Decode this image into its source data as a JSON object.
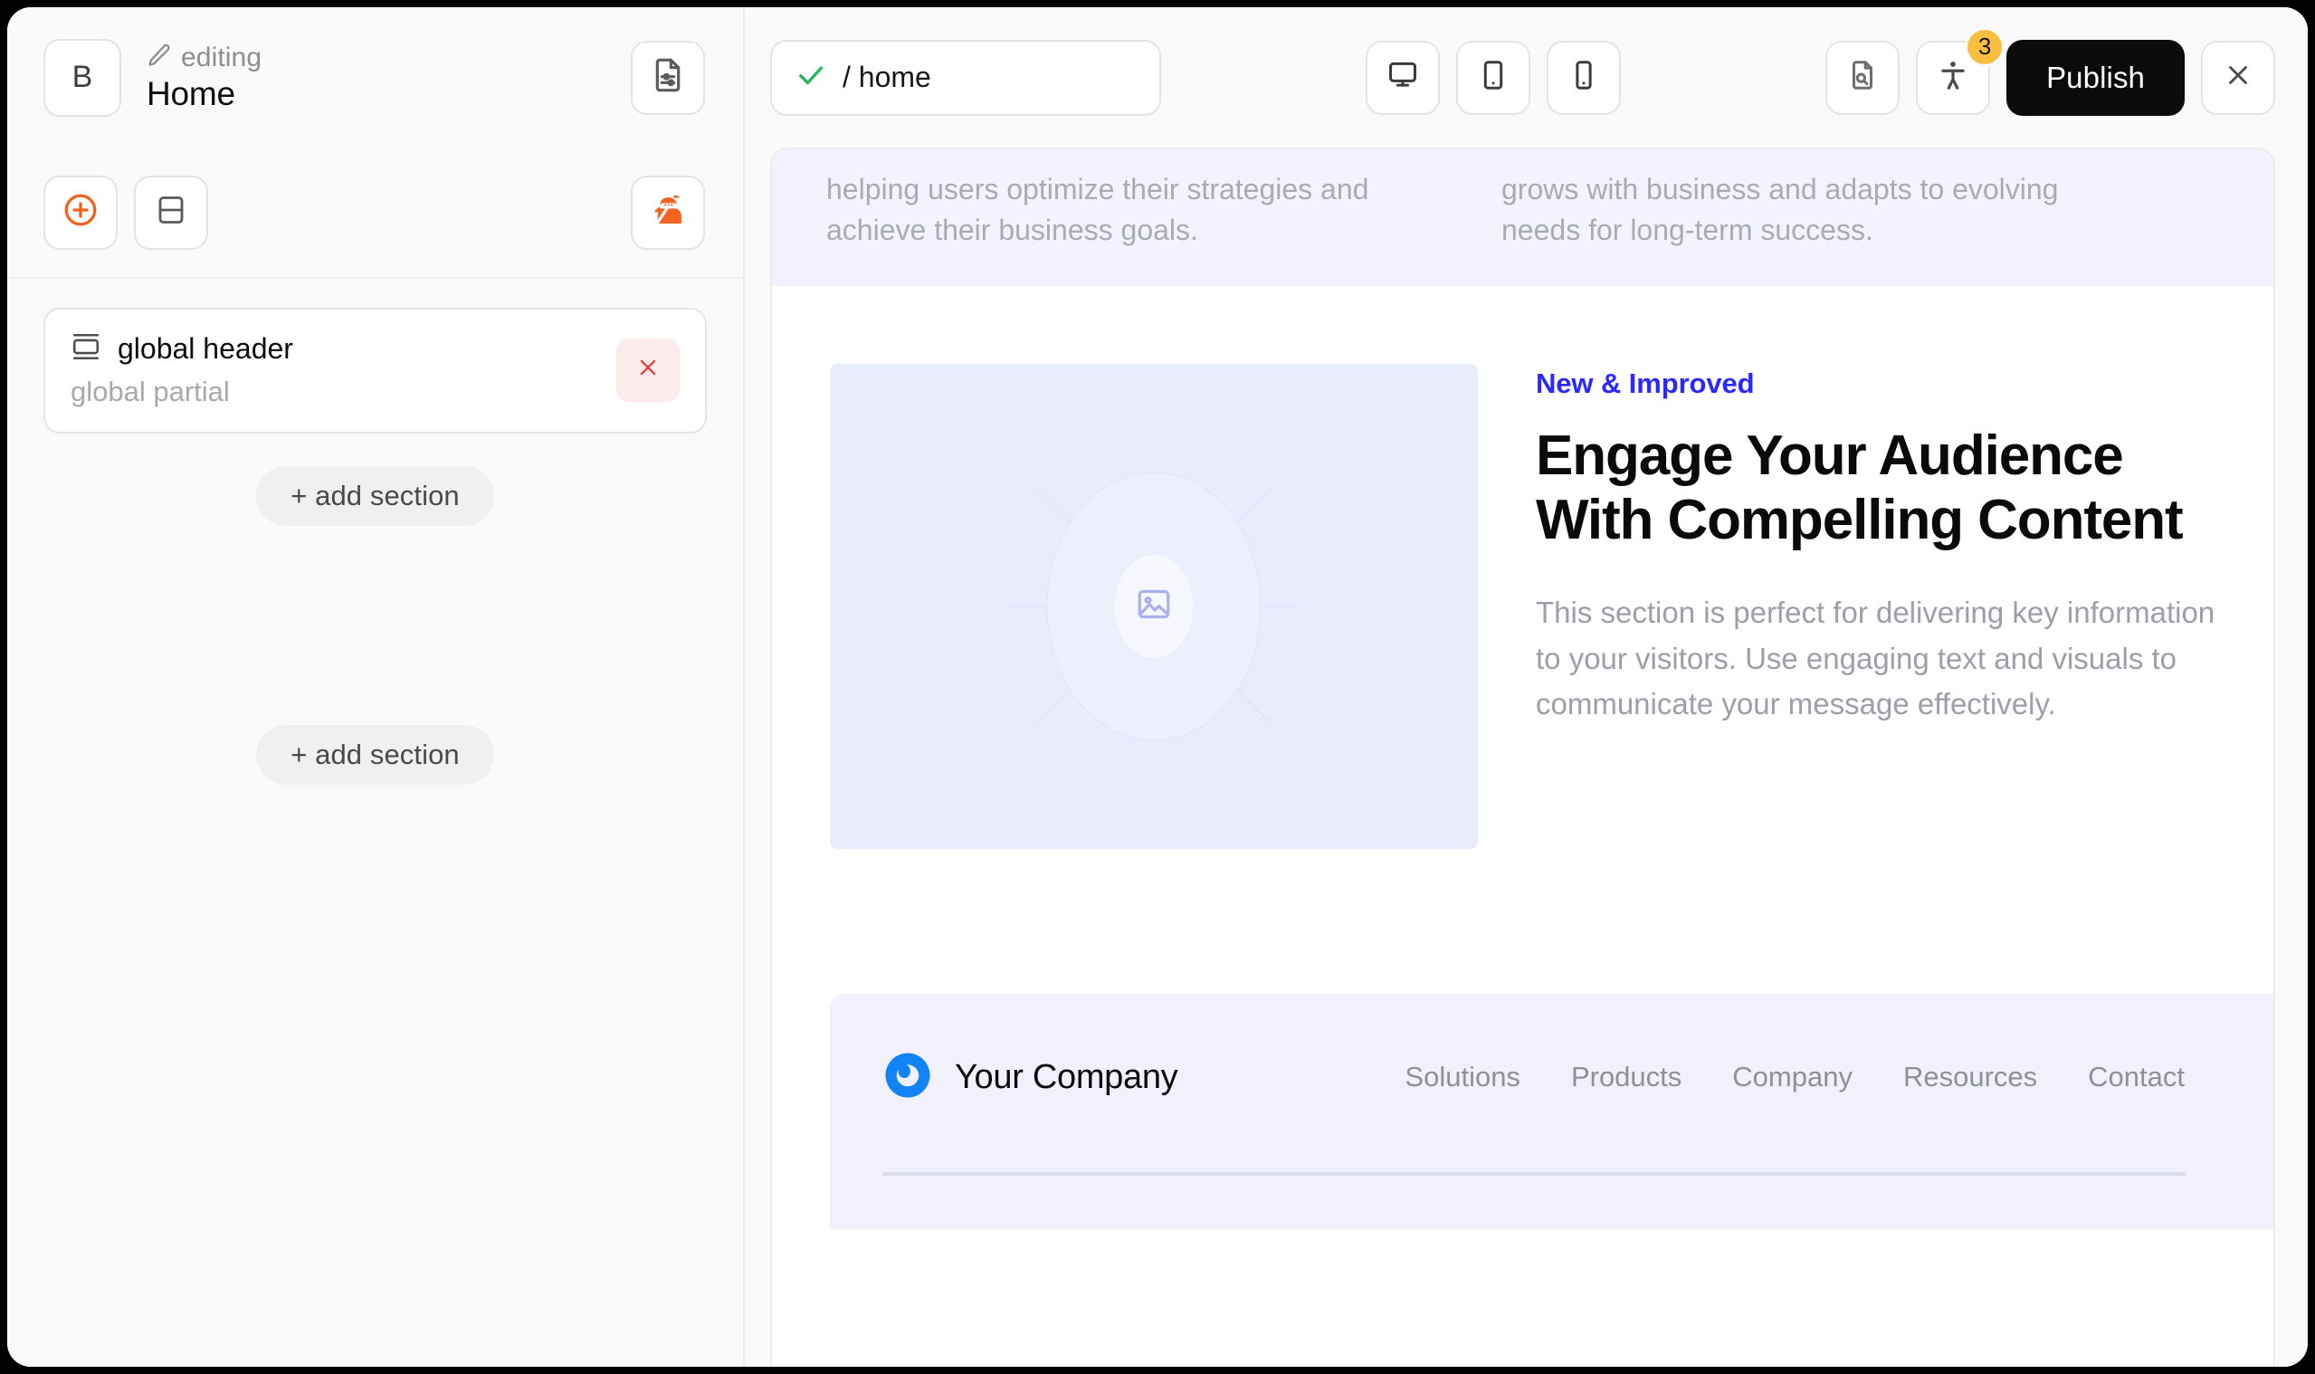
{
  "left_panel": {
    "brand_initial": "B",
    "editing_label": "editing",
    "page_title": "Home",
    "page_settings_icon": "document-sliders-icon",
    "add_block_icon": "plus-circle-icon",
    "layout_icon": "split-layout-icon",
    "assistant_icon": "ninja-mascot-icon",
    "sections": [
      {
        "icon": "global-header-icon",
        "title": "global header",
        "subtitle": "global partial",
        "delete_label": "✕"
      }
    ],
    "add_section_label": "+ add section",
    "add_section_label_2": "+ add section"
  },
  "toolbar": {
    "url_status_icon": "check-icon",
    "url_value": "/ home",
    "url_placeholder": "/ home",
    "devices": [
      {
        "name": "desktop",
        "icon": "desktop-icon",
        "active": true
      },
      {
        "name": "tablet",
        "icon": "tablet-icon",
        "active": false
      },
      {
        "name": "mobile",
        "icon": "mobile-icon",
        "active": false
      }
    ],
    "seo_icon": "document-search-icon",
    "accessibility_icon": "accessibility-icon",
    "accessibility_badge": "3",
    "publish_label": "Publish",
    "close_label": "✕"
  },
  "canvas": {
    "band_top": {
      "left_text": "helping users optimize their strategies and achieve their business goals.",
      "right_text": "grows with business and adapts to evolving needs for long-term success."
    },
    "hero": {
      "image_placeholder_icon": "image-placeholder-icon",
      "eyebrow": "New & Improved",
      "heading": "Engage Your Audience With Compelling Content",
      "paragraph": "This section is perfect for delivering key information to your visitors. Use engaging text and visuals to communicate your message effectively."
    },
    "footer": {
      "logo_icon": "company-logo-icon",
      "company_name": "Your Company",
      "nav": [
        {
          "label": "Solutions"
        },
        {
          "label": "Products"
        },
        {
          "label": "Company"
        },
        {
          "label": "Resources"
        },
        {
          "label": "Contact"
        }
      ]
    }
  },
  "colors": {
    "accent_orange": "#f4621f",
    "publish_bg": "#0b0b0b",
    "badge_bg": "#fbbf3f",
    "eyebrow_blue": "#2b28ff",
    "logo_blue": "#1183f5",
    "band_lavender": "#f2f3fe",
    "delete_red": "#e24a4a",
    "check_green": "#2bb563"
  }
}
